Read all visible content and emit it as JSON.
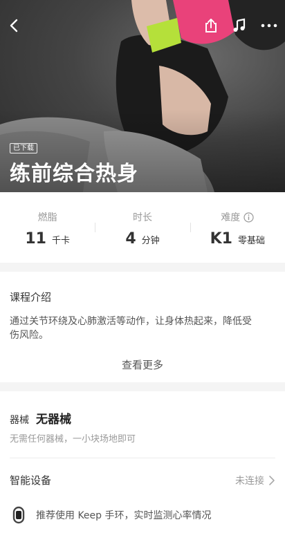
{
  "hero": {
    "badge": "已下载",
    "title": "练前综合热身",
    "icons": [
      "back-arrow-icon",
      "share-icon",
      "music-note-icon",
      "more-dots-icon"
    ]
  },
  "stats": [
    {
      "label": "燃脂",
      "value": "11",
      "unit": "千卡"
    },
    {
      "label": "时长",
      "value": "4",
      "unit": "分钟"
    },
    {
      "label": "难度",
      "value": "K1",
      "unit": "零基础",
      "info_icon": "info-circle-icon"
    }
  ],
  "intro": {
    "title": "课程介绍",
    "description": "通过关节环绕及心肺激活等动作，让身体热起来，降低受伤风险。",
    "more_label": "查看更多"
  },
  "equipment": {
    "label": "器械",
    "value": "无器械",
    "hint": "无需任何器械，一小块场地即可",
    "smart_device_label": "智能设备",
    "smart_device_status": "未连接",
    "band_tip": "推荐使用 Keep 手环，实时监测心率情况"
  },
  "colors": {
    "accent_pink": "#e9427a",
    "wristband_green": "#b5e03a",
    "text_primary": "#333333",
    "text_secondary": "#999999"
  }
}
